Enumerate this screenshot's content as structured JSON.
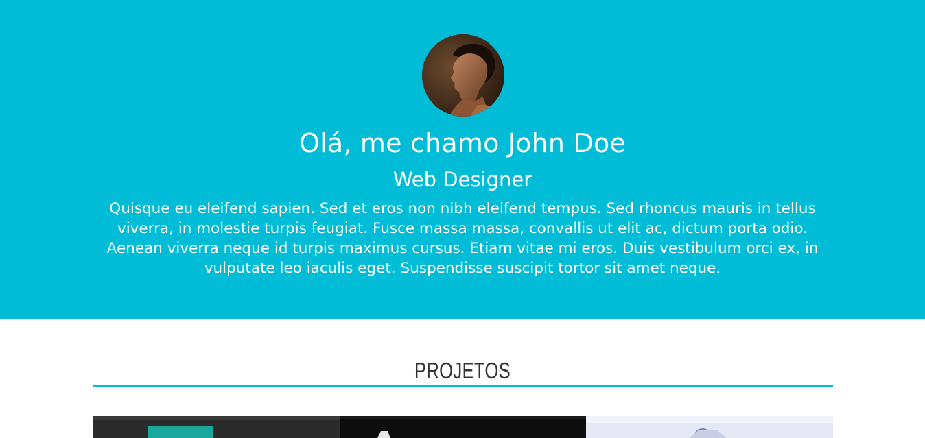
{
  "hero": {
    "title": "Olá, me chamo John Doe",
    "subtitle": "Web Designer",
    "bio": "Quisque eu eleifend sapien. Sed et eros non nibh eleifend tempus. Sed rhoncus mauris in tellus viverra, in molestie turpis feugiat. Fusce massa massa, convallis ut elit ac, dictum porta odio. Aenean viverra neque id turpis maximus cursus. Etiam vitae mi eros. Duis vestibulum orci ex, in vulputate leo iaculis eget. Suspendisse suscipit tortor sit amet neque."
  },
  "projects": {
    "heading": "PROJETOS"
  },
  "colors": {
    "accent": "#00bcd6",
    "heading_text": "#333333",
    "background": "#ffffff"
  }
}
